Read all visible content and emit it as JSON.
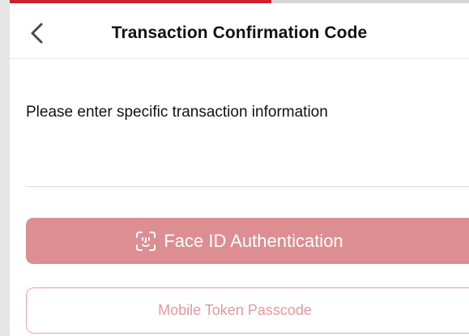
{
  "header": {
    "title": "Transaction Confirmation Code",
    "back_icon": "chevron-left-icon"
  },
  "progress": {
    "fraction": 0.57,
    "fill_color": "#d0212b",
    "track_color": "#d6d6d6"
  },
  "form": {
    "instruction": "Please enter specific transaction information"
  },
  "actions": {
    "face_id_label": "Face ID Authentication",
    "face_id_icon": "face-id-icon",
    "face_id_color": "#dc8e92",
    "token_label": "Mobile Token Passcode",
    "token_border_color": "#e8a3a6"
  }
}
